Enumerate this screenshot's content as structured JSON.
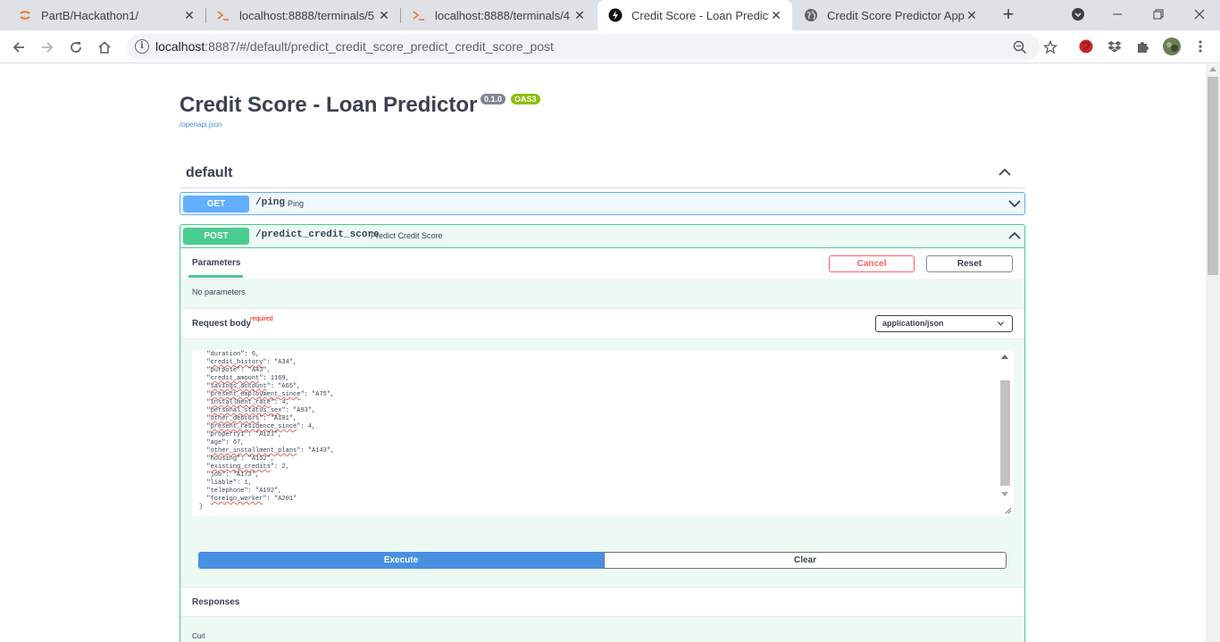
{
  "browser": {
    "tabs": [
      {
        "title": "PartB/Hackathon1/",
        "favicon": "jupyter-icon"
      },
      {
        "title": "localhost:8888/terminals/5",
        "favicon": "terminal-icon"
      },
      {
        "title": "localhost:8888/terminals/4",
        "favicon": "terminal-icon"
      },
      {
        "title": "Credit Score - Loan Predictor",
        "favicon": "bolt-icon",
        "active": true
      },
      {
        "title": "Credit Score Predictor App",
        "favicon": "globe-icon"
      }
    ],
    "url_host": "localhost",
    "url_rest": ":8887/#/default/predict_credit_score_predict_credit_score_post"
  },
  "header": {
    "title": "Credit Score - Loan Predictor",
    "version": "0.1.0",
    "oas": "OAS3",
    "openapi_link": "/openapi.json"
  },
  "section": {
    "title": "default"
  },
  "operations": {
    "get": {
      "method": "GET",
      "path": "/ping",
      "summary": "Ping"
    },
    "post": {
      "method": "POST",
      "path": "/predict_credit_score",
      "summary": "Predict Credit Score",
      "tab_parameters": "Parameters",
      "cancel_label": "Cancel",
      "reset_label": "Reset",
      "no_params": "No parameters",
      "request_body_label": "Request body",
      "required_label": "required",
      "content_type": "application/json",
      "execute_label": "Execute",
      "clear_label": "Clear",
      "responses_label": "Responses",
      "curl_label": "Curl"
    }
  },
  "request_body_lines": [
    {
      "key": "duration",
      "value": "6,",
      "squiggle": false
    },
    {
      "key": "credit_history",
      "value": "\"A34\",",
      "squiggle": true
    },
    {
      "key": "purpose",
      "value": "\"A43\",",
      "squiggle": false
    },
    {
      "key": "credit_amount",
      "value": "1169,",
      "squiggle": true
    },
    {
      "key": "savings_account",
      "value": "\"A65\",",
      "squiggle": true
    },
    {
      "key": "present_employment_since",
      "value": "\"A75\",",
      "squiggle": true
    },
    {
      "key": "installment_rate",
      "value": "4,",
      "squiggle": true
    },
    {
      "key": "personal_status_sex",
      "value": "\"A93\",",
      "squiggle": true
    },
    {
      "key": "other_debtors",
      "value": "\"A101\",",
      "squiggle": true
    },
    {
      "key": "present_residence_since",
      "value": "4,",
      "squiggle": true
    },
    {
      "key": "property1",
      "value": "\"A121\",",
      "squiggle": false
    },
    {
      "key": "age",
      "value": "67,",
      "squiggle": false
    },
    {
      "key": "other_installment_plans",
      "value": "\"A143\",",
      "squiggle": true
    },
    {
      "key": "housing",
      "value": "\"A152\",",
      "squiggle": false
    },
    {
      "key": "existing_credits",
      "value": "2,",
      "squiggle": true
    },
    {
      "key": "job",
      "value": "\"A173\",",
      "squiggle": false
    },
    {
      "key": "liable",
      "value": "1,",
      "squiggle": false
    },
    {
      "key": "telephone",
      "value": "\"A192\",",
      "squiggle": false
    },
    {
      "key": "foreign_worker",
      "value": "\"A201\"",
      "squiggle": true
    }
  ],
  "colors": {
    "get": "#61affe",
    "post": "#49cc90",
    "execute": "#4990e2",
    "cancel": "#ff6060"
  }
}
